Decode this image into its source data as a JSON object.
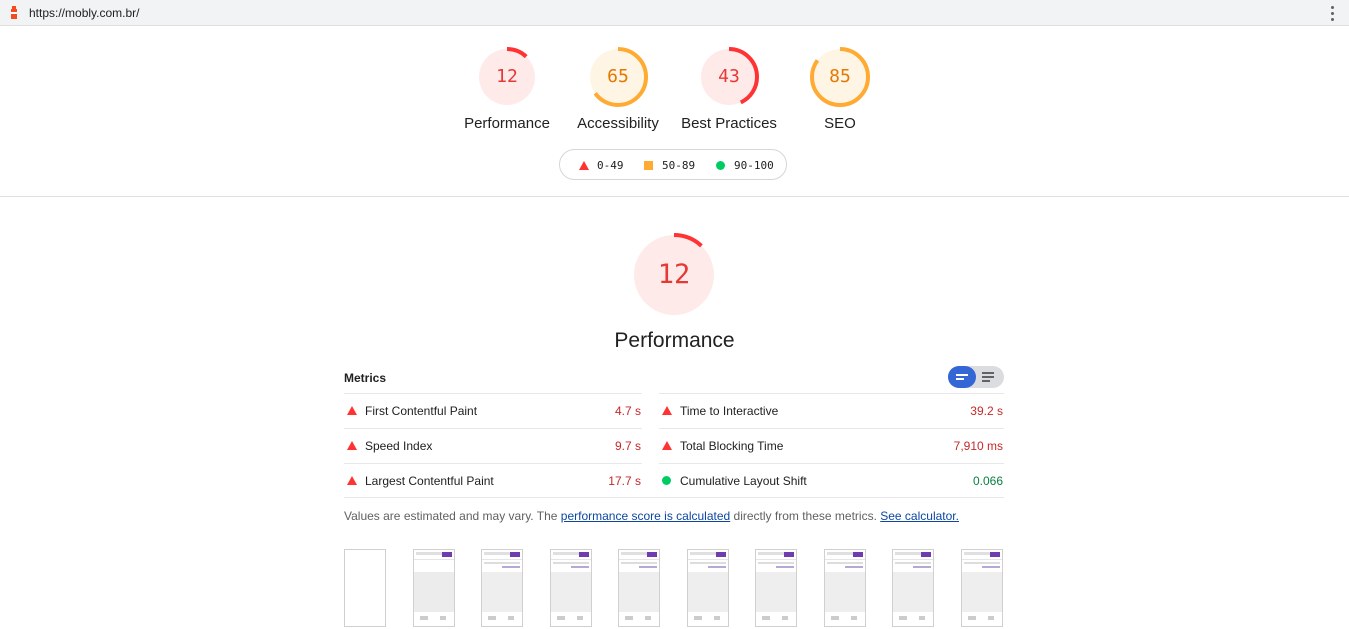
{
  "topbar": {
    "url": "https://mobly.com.br/"
  },
  "colors": {
    "fail": "#ff3333",
    "average": "#ffaa33",
    "pass": "#00cc66",
    "accent": "#3367d6"
  },
  "scores": [
    {
      "label": "Performance",
      "score": 12,
      "rating": "fail"
    },
    {
      "label": "Accessibility",
      "score": 65,
      "rating": "average"
    },
    {
      "label": "Best Practices",
      "score": 43,
      "rating": "fail"
    },
    {
      "label": "SEO",
      "score": 85,
      "rating": "average"
    }
  ],
  "legend": {
    "fail": "0-49",
    "average": "50-89",
    "pass": "90-100"
  },
  "performance": {
    "score": 12,
    "title": "Performance"
  },
  "metrics": {
    "header": "Metrics",
    "items": [
      {
        "name": "First Contentful Paint",
        "value": "4.7 s",
        "rating": "fail"
      },
      {
        "name": "Time to Interactive",
        "value": "39.2 s",
        "rating": "fail"
      },
      {
        "name": "Speed Index",
        "value": "9.7 s",
        "rating": "fail"
      },
      {
        "name": "Total Blocking Time",
        "value": "7,910 ms",
        "rating": "fail"
      },
      {
        "name": "Largest Contentful Paint",
        "value": "17.7 s",
        "rating": "fail"
      },
      {
        "name": "Cumulative Layout Shift",
        "value": "0.066",
        "rating": "pass"
      }
    ]
  },
  "note": {
    "prefix": "Values are estimated and may vary. The ",
    "link1": "performance score is calculated",
    "middle": " directly from these metrics. ",
    "link2": "See calculator."
  },
  "filmstrip": {
    "frames": [
      "blank",
      "early",
      "loaded",
      "loaded",
      "loaded",
      "loaded",
      "loaded",
      "loaded",
      "loaded",
      "loaded"
    ]
  }
}
